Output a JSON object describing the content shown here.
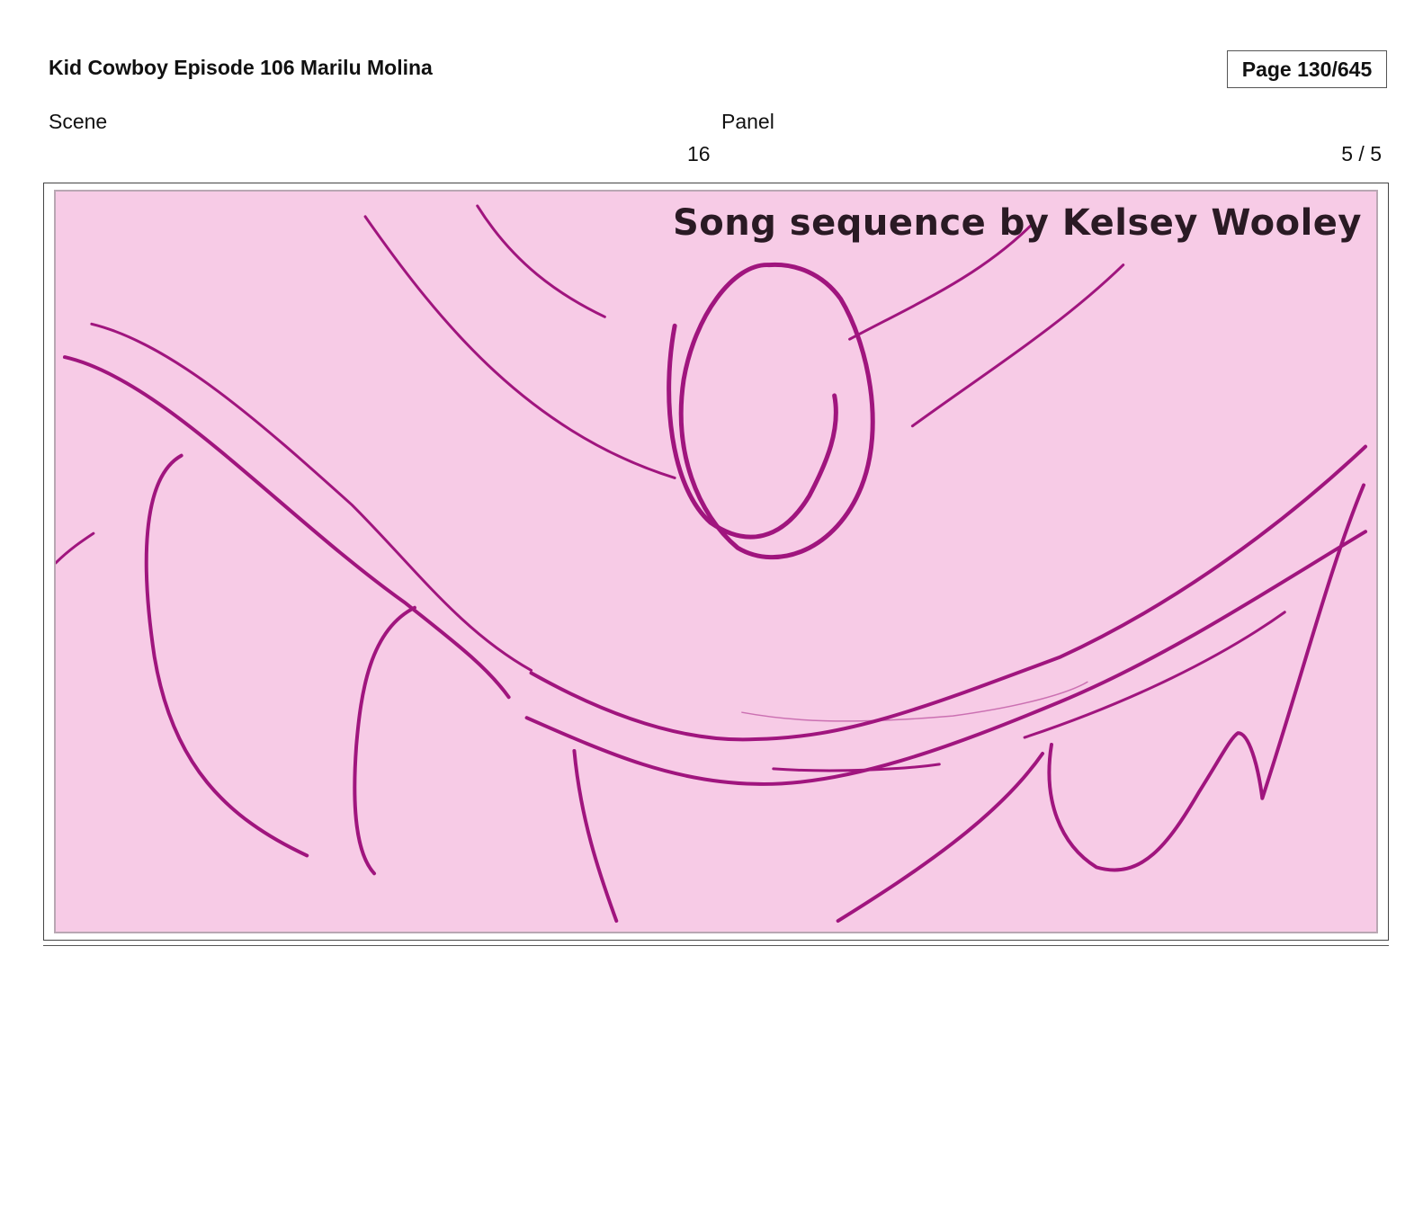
{
  "header": {
    "title": "Kid Cowboy Episode 106 Marilu Molina",
    "page": "Page 130/645"
  },
  "labels": {
    "scene": "Scene",
    "panel": "Panel"
  },
  "values": {
    "scene": "16",
    "panel": "5 / 5"
  },
  "frame": {
    "caption": "Song sequence by Kelsey Wooley",
    "background_color": "#f7cbe6",
    "stroke_color": "#a0157e"
  }
}
